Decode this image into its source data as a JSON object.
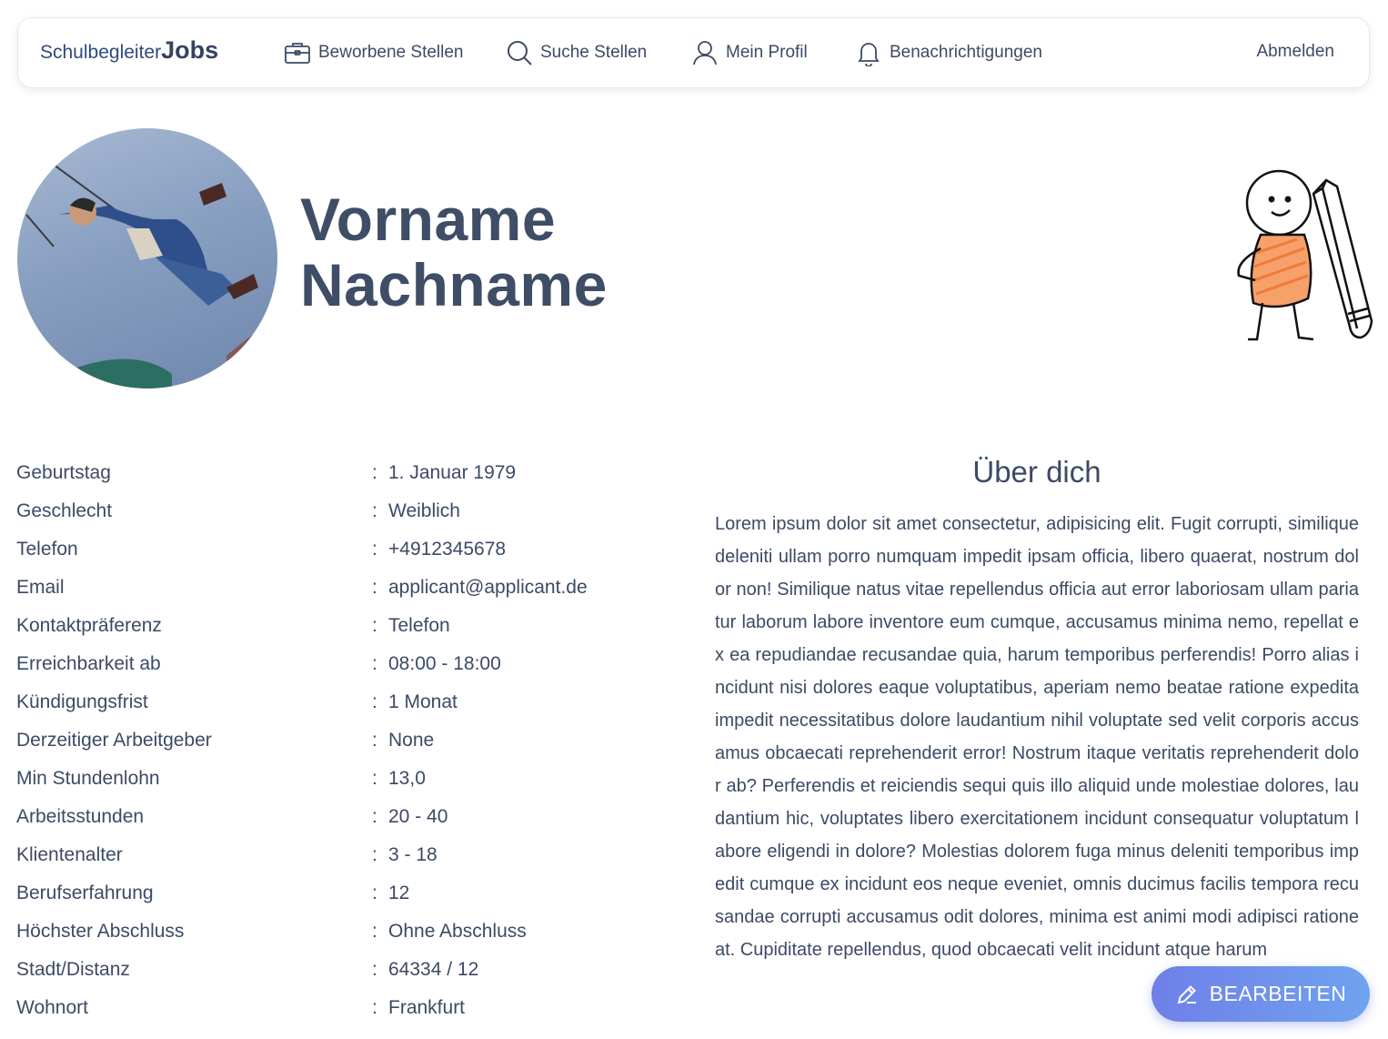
{
  "brand": {
    "part1": "Schulbegleiter",
    "part2": "Jobs"
  },
  "nav": {
    "items": [
      {
        "label": "Beworbene Stellen",
        "icon": "briefcase-icon"
      },
      {
        "label": "Suche Stellen",
        "icon": "search-icon"
      },
      {
        "label": "Mein Profil",
        "icon": "user-icon"
      },
      {
        "label": "Benachrichtigungen",
        "icon": "bell-icon"
      }
    ],
    "logout": "Abmelden"
  },
  "profile": {
    "first_name": "Vorname",
    "last_name": "Nachname",
    "photo": "avatar-photo"
  },
  "details": [
    {
      "label": "Geburtstag",
      "value": "1. Januar 1979"
    },
    {
      "label": "Geschlecht",
      "value": "Weiblich"
    },
    {
      "label": "Telefon",
      "value": "+4912345678"
    },
    {
      "label": "Email",
      "value": "applicant@applicant.de"
    },
    {
      "label": "Kontaktpräferenz",
      "value": "Telefon"
    },
    {
      "label": "Erreichbarkeit ab",
      "value": "08:00 - 18:00"
    },
    {
      "label": "Kündigungsfrist",
      "value": "1 Monat"
    },
    {
      "label": "Derzeitiger Arbeitgeber",
      "value": "None"
    },
    {
      "label": "Min Stundenlohn",
      "value": "13,0"
    },
    {
      "label": "Arbeitsstunden",
      "value": "20 - 40"
    },
    {
      "label": "Klientenalter",
      "value": "3 - 18"
    },
    {
      "label": "Berufserfahrung",
      "value": "12"
    },
    {
      "label": "Höchster Abschluss",
      "value": "Ohne Abschluss"
    },
    {
      "label": "Stadt/Distanz",
      "value": "64334 / 12"
    },
    {
      "label": "Wohnort",
      "value": "Frankfurt"
    }
  ],
  "separator": ":",
  "about": {
    "title": "Über dich",
    "text": "Lorem ipsum dolor sit amet consectetur, adipisicing elit. Fugit corrupti, similique deleniti ullam porro numquam impedit ipsam officia, libero quaerat, nostrum dolor non! Similique natus vitae repellendus officia aut error laboriosam ullam pariatur laborum labore inventore eum cumque, accusamus minima nemo, repellat ex ea repudiandae recusandae quia, harum temporibus perferendis! Porro alias incidunt nisi dolores eaque voluptatibus, aperiam nemo beatae ratione expedita impedit necessitatibus dolore laudantium nihil voluptate sed velit corporis accusamus obcaecati reprehenderit error! Nostrum itaque veritatis reprehenderit dolor ab? Perferendis et reiciendis sequi quis illo aliquid unde molestiae dolores, laudantium hic, voluptates libero exercitationem incidunt consequatur voluptatum labore eligendi in dolore? Molestias dolorem fuga minus deleniti temporibus impedit cumque ex incidunt eos neque eveniet, omnis ducimus facilis tempora recusandae corrupti accusamus odit dolores, minima est animi modi adipisci ratione at. Cupiditate repellendus, quod obcaecati velit incidunt atque harum"
  },
  "edit_button": {
    "label": "BEARBEITEN",
    "icon": "pencil-icon"
  },
  "colors": {
    "text": "#3c4a66",
    "accent_start": "#6f7fe8",
    "accent_end": "#6fa3ef",
    "illustration_orange": "#f08a4b"
  }
}
